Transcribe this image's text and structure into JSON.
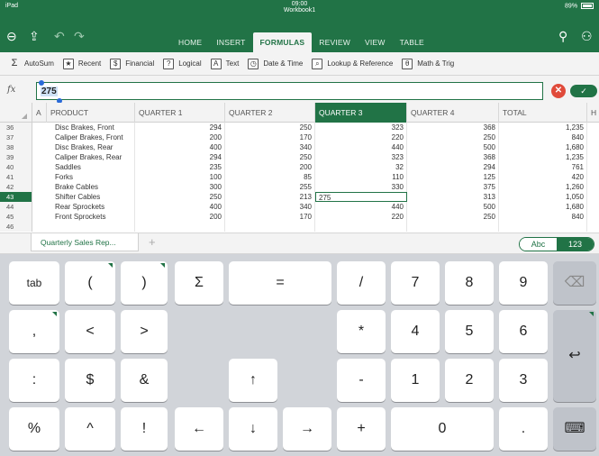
{
  "status": {
    "device": "iPad",
    "time": "09:00",
    "workbook": "Workbook1",
    "battery": "89%"
  },
  "ribbon_tabs": [
    {
      "label": "HOME",
      "active": false
    },
    {
      "label": "INSERT",
      "active": false
    },
    {
      "label": "FORMULAS",
      "active": true
    },
    {
      "label": "REVIEW",
      "active": false
    },
    {
      "label": "VIEW",
      "active": false
    },
    {
      "label": "TABLE",
      "active": false
    }
  ],
  "ribbon": [
    {
      "label": "AutoSum",
      "icon": "Σ"
    },
    {
      "label": "Recent",
      "icon": "★"
    },
    {
      "label": "Financial",
      "icon": "$"
    },
    {
      "label": "Logical",
      "icon": "?"
    },
    {
      "label": "Text",
      "icon": "A"
    },
    {
      "label": "Date & Time",
      "icon": "◷"
    },
    {
      "label": "Lookup & Reference",
      "icon": "⌕"
    },
    {
      "label": "Math & Trig",
      "icon": "θ"
    }
  ],
  "formula": {
    "fx": "fx",
    "value": "275"
  },
  "columns": [
    "A",
    "PRODUCT",
    "QUARTER 1",
    "QUARTER 2",
    "QUARTER 3",
    "QUARTER 4",
    "TOTAL",
    "H"
  ],
  "active_column": "QUARTER 3",
  "rows": [
    {
      "n": "36",
      "product": "Disc Brakes, Front",
      "q1": "294",
      "q2": "250",
      "q3": "323",
      "q4": "368",
      "total": "1,235"
    },
    {
      "n": "37",
      "product": "Caliper Brakes, Front",
      "q1": "200",
      "q2": "170",
      "q3": "220",
      "q4": "250",
      "total": "840"
    },
    {
      "n": "38",
      "product": "Disc Brakes, Rear",
      "q1": "400",
      "q2": "340",
      "q3": "440",
      "q4": "500",
      "total": "1,680"
    },
    {
      "n": "39",
      "product": "Caliper Brakes, Rear",
      "q1": "294",
      "q2": "250",
      "q3": "323",
      "q4": "368",
      "total": "1,235"
    },
    {
      "n": "40",
      "product": "Saddles",
      "q1": "235",
      "q2": "200",
      "q3": "32",
      "q4": "294",
      "total": "761"
    },
    {
      "n": "41",
      "product": "Forks",
      "q1": "100",
      "q2": "85",
      "q3": "110",
      "q4": "125",
      "total": "420"
    },
    {
      "n": "42",
      "product": "Brake Cables",
      "q1": "300",
      "q2": "255",
      "q3": "330",
      "q4": "375",
      "total": "1,260"
    },
    {
      "n": "43",
      "product": "Shifter Cables",
      "q1": "250",
      "q2": "213",
      "q3": "275",
      "q4": "313",
      "total": "1,050"
    },
    {
      "n": "44",
      "product": "Rear Sprockets",
      "q1": "400",
      "q2": "340",
      "q3": "440",
      "q4": "500",
      "total": "1,680"
    },
    {
      "n": "45",
      "product": "Front Sprockets",
      "q1": "200",
      "q2": "170",
      "q3": "220",
      "q4": "250",
      "total": "840"
    },
    {
      "n": "46",
      "product": "",
      "q1": "",
      "q2": "",
      "q3": "",
      "q4": "",
      "total": ""
    }
  ],
  "active_row": "43",
  "sheet_tab": "Quarterly Sales Rep...",
  "add_sheet": "+",
  "kb_toggle": {
    "abc": "Abc",
    "num": "123"
  },
  "keys": {
    "tab": "tab",
    "lparen": "(",
    "rparen": ")",
    "sigma": "Σ",
    "equals": "=",
    "slash": "/",
    "k7": "7",
    "k8": "8",
    "k9": "9",
    "comma": ",",
    "lt": "<",
    "gt": ">",
    "star": "*",
    "k4": "4",
    "k5": "5",
    "k6": "6",
    "colon": ":",
    "dollar": "$",
    "amp": "&",
    "up": "↑",
    "minus": "-",
    "k1": "1",
    "k2": "2",
    "k3": "3",
    "percent": "%",
    "caret": "^",
    "bang": "!",
    "left": "←",
    "down": "↓",
    "right": "→",
    "plus": "+",
    "k0": "0",
    "dot": ".",
    "backspace": "⌫",
    "enter": "↩",
    "hide": "⌨"
  }
}
